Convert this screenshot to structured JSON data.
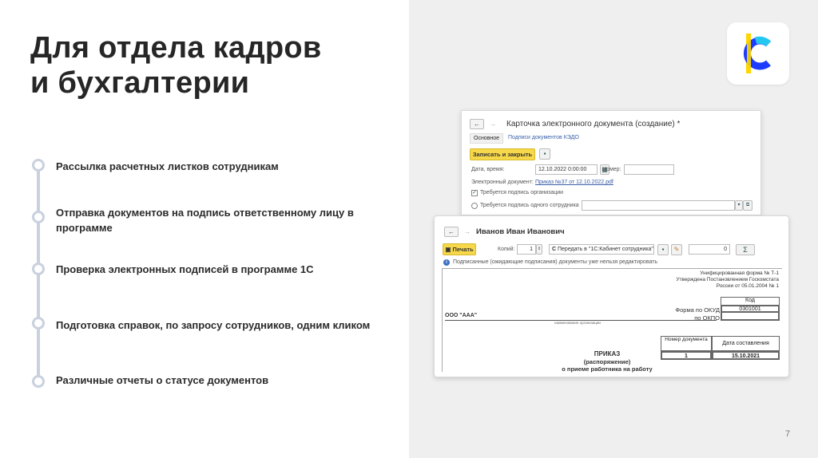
{
  "slide": {
    "title_line1": "Для отдела кадров",
    "title_line2": "и бухгалтерии",
    "page_number": "7"
  },
  "features": [
    {
      "text": "Рассылка расчетных листков сотрудникам"
    },
    {
      "text": "Отправка документов на подпись ответственному лицу в программе"
    },
    {
      "text": "Проверка электронных подписей в программе 1С"
    },
    {
      "text": "Подготовка справок, по запросу сотрудников, одним кликом"
    },
    {
      "text": "Различные отчеты о статусе документов"
    }
  ],
  "logo": {
    "icon": "1c-logo-icon",
    "colors": {
      "blue": "#1e3cff",
      "yellow": "#ffd600",
      "cyan": "#22c8f0"
    }
  },
  "window1": {
    "back": "←",
    "forward": "→",
    "title": "Карточка электронного документа (создание) *",
    "tab_main": "Основное",
    "tab_signatures": "Подписи документов КЭДО",
    "save_close": "Записать и закрыть",
    "date_label": "Дата, время:",
    "date_value": "12.10.2022 0:00:00",
    "number_label": "Номер:",
    "number_value": "",
    "edoc_label": "Электронный документ:",
    "edoc_value": "Приказ №37 от 12.10.2022.pdf",
    "org_signature": "Требуется подпись организации",
    "emp_signature": "Требуется подпись одного сотрудника"
  },
  "window2": {
    "back": "←",
    "forward": "→",
    "title": "Иванов Иван Иванович",
    "print": "Печать",
    "copies_label": "Копий:",
    "copies_value": "1",
    "send_to": "Передать в \"1С:Кабинет сотрудника\"",
    "sum_value": "0",
    "sigma": "Σ",
    "info": "Подписанные (ожидающие подписания) документы уже нельзя редактировать",
    "doc": {
      "form_line1": "Унифицированная форма № Т-1",
      "form_line2": "Утверждена Постановлением Госкомстата",
      "form_line3": "России от 05.01.2004 № 1",
      "code_header": "Код",
      "okud_label": "Форма по ОКУД",
      "okud_value": "0301001",
      "okpo_label": "по ОКПО",
      "okpo_value": "",
      "org_name": "ООО \"ААА\"",
      "org_caption": "наименование организации",
      "doc_number_header": "Номер документа",
      "doc_date_header": "Дата составления",
      "doc_number_value": "1",
      "doc_date_value": "15.10.2021",
      "order_line1": "ПРИКАЗ",
      "order_line2": "(распоряжение)",
      "order_line3": "о приеме работника на работу"
    }
  }
}
